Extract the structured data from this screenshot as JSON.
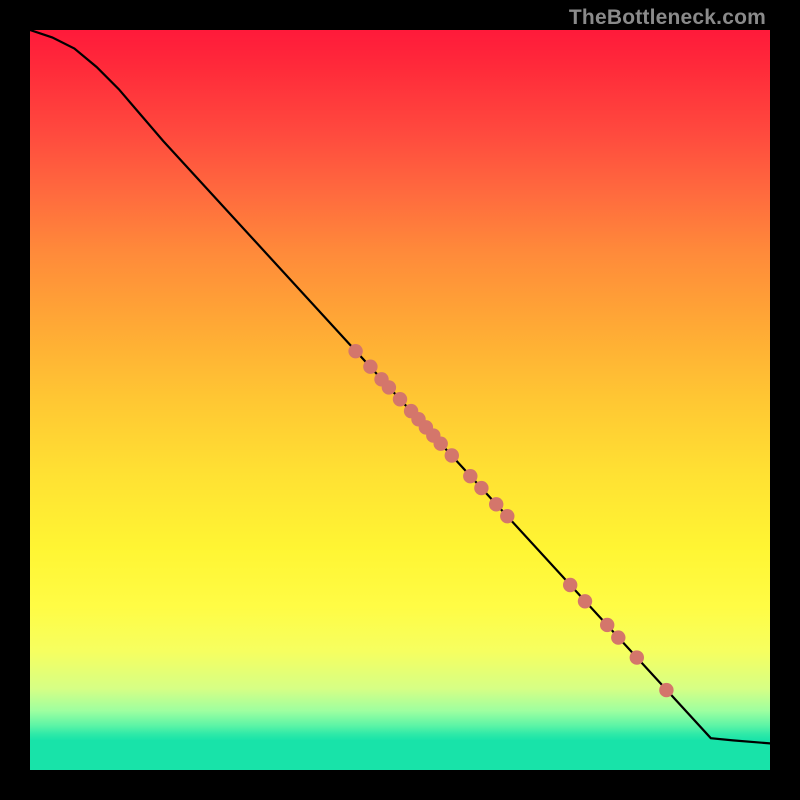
{
  "watermark": "TheBottleneck.com",
  "colors": {
    "marker": "#d4766b",
    "curve": "#000000",
    "frame_bg_top": "#ff1a3a",
    "frame_bg_bottom": "#18e3a9",
    "page_bg": "#000000"
  },
  "chart_data": {
    "type": "line",
    "title": "",
    "xlabel": "",
    "ylabel": "",
    "xlim": [
      0,
      100
    ],
    "ylim": [
      0,
      100
    ],
    "grid": false,
    "curve": [
      {
        "x": 0,
        "y": 100
      },
      {
        "x": 3,
        "y": 99
      },
      {
        "x": 6,
        "y": 97.5
      },
      {
        "x": 9,
        "y": 95
      },
      {
        "x": 12,
        "y": 92
      },
      {
        "x": 15,
        "y": 88.5
      },
      {
        "x": 18,
        "y": 85
      },
      {
        "x": 92,
        "y": 4.3
      },
      {
        "x": 95,
        "y": 4.0
      },
      {
        "x": 100,
        "y": 3.6
      }
    ],
    "markers_on_line": [
      {
        "x": 44,
        "y": 56.6
      },
      {
        "x": 46,
        "y": 54.5
      },
      {
        "x": 47.5,
        "y": 52.8
      },
      {
        "x": 48.5,
        "y": 51.7
      },
      {
        "x": 50,
        "y": 50.1
      },
      {
        "x": 51.5,
        "y": 48.5
      },
      {
        "x": 52.5,
        "y": 47.4
      },
      {
        "x": 53.5,
        "y": 46.3
      },
      {
        "x": 54.5,
        "y": 45.2
      },
      {
        "x": 55.5,
        "y": 44.1
      },
      {
        "x": 57,
        "y": 42.5
      },
      {
        "x": 59.5,
        "y": 39.7
      },
      {
        "x": 61,
        "y": 38.1
      },
      {
        "x": 63,
        "y": 35.9
      },
      {
        "x": 64.5,
        "y": 34.3
      },
      {
        "x": 73,
        "y": 25.0
      },
      {
        "x": 75,
        "y": 22.8
      },
      {
        "x": 78,
        "y": 19.6
      },
      {
        "x": 79.5,
        "y": 17.9
      },
      {
        "x": 82,
        "y": 15.2
      },
      {
        "x": 86,
        "y": 10.8
      }
    ]
  }
}
